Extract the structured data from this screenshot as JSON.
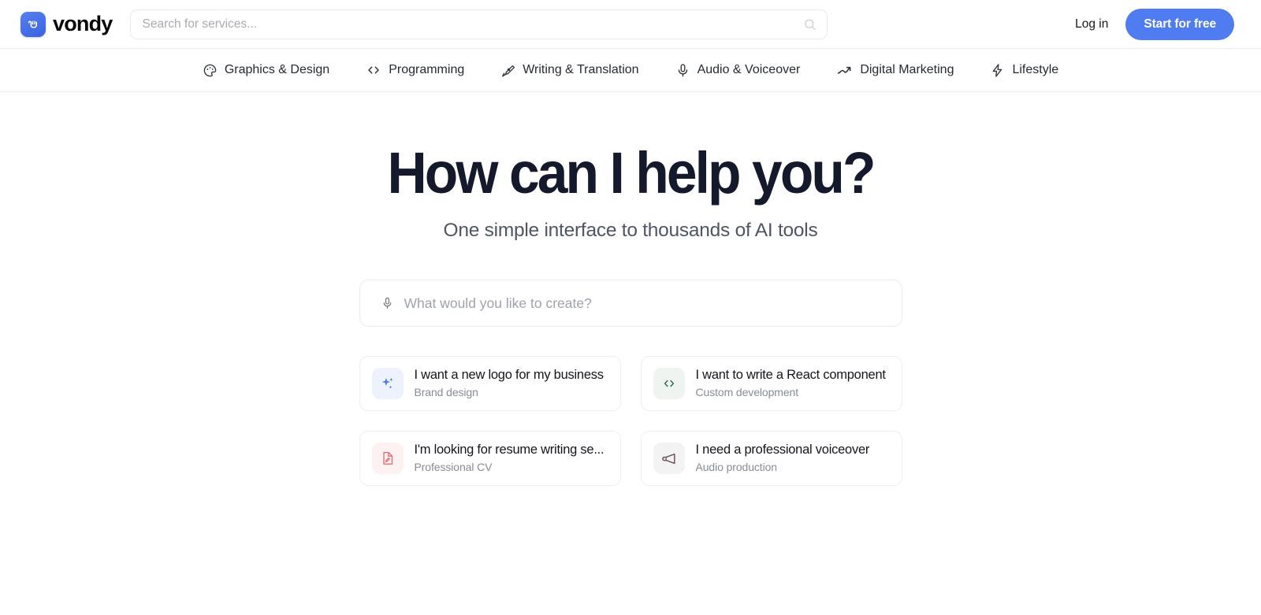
{
  "header": {
    "brand_name": "vondy",
    "logo_icon": "vondy-shaka-logo-icon",
    "search_placeholder": "Search for services...",
    "search_value": "",
    "search_icon": "search-icon",
    "login_label": "Log in",
    "cta_label": "Start for free"
  },
  "nav": {
    "items": [
      {
        "label": "Graphics & Design",
        "icon": "palette-icon"
      },
      {
        "label": "Programming",
        "icon": "code-brackets-icon"
      },
      {
        "label": "Writing & Translation",
        "icon": "pen-nib-icon"
      },
      {
        "label": "Audio & Voiceover",
        "icon": "microphone-icon"
      },
      {
        "label": "Digital Marketing",
        "icon": "trending-up-icon"
      },
      {
        "label": "Lifestyle",
        "icon": "lightning-bolt-icon"
      }
    ]
  },
  "hero": {
    "title": "How can I help you?",
    "subtitle": "One simple interface to thousands of AI tools"
  },
  "prompt": {
    "placeholder": "What would you like to create?",
    "value": "",
    "mic_icon": "microphone-icon"
  },
  "suggestions": [
    {
      "title": "I want a new logo for my business",
      "subtitle": "Brand design",
      "icon": "sparkles-icon",
      "icon_color": "#4f7cf0",
      "icon_bg": "#eef2fd"
    },
    {
      "title": "I want to write a React component",
      "subtitle": "Custom development",
      "icon": "code-brackets-icon",
      "icon_color": "#2f7055",
      "icon_bg": "#eff4f1"
    },
    {
      "title": "I'm looking for resume writing se...",
      "subtitle": "Professional CV",
      "icon": "file-pen-icon",
      "icon_color": "#e0727a",
      "icon_bg": "#fdf1f1"
    },
    {
      "title": "I need a professional voiceover",
      "subtitle": "Audio production",
      "icon": "megaphone-icon",
      "icon_color": "#6b565a",
      "icon_bg": "#f4f3f3"
    }
  ],
  "colors": {
    "accent_blue": "#4f7cf0",
    "heading_navy": "#141a2b",
    "border_gray": "#eceef1",
    "muted_text": "#878c96"
  }
}
